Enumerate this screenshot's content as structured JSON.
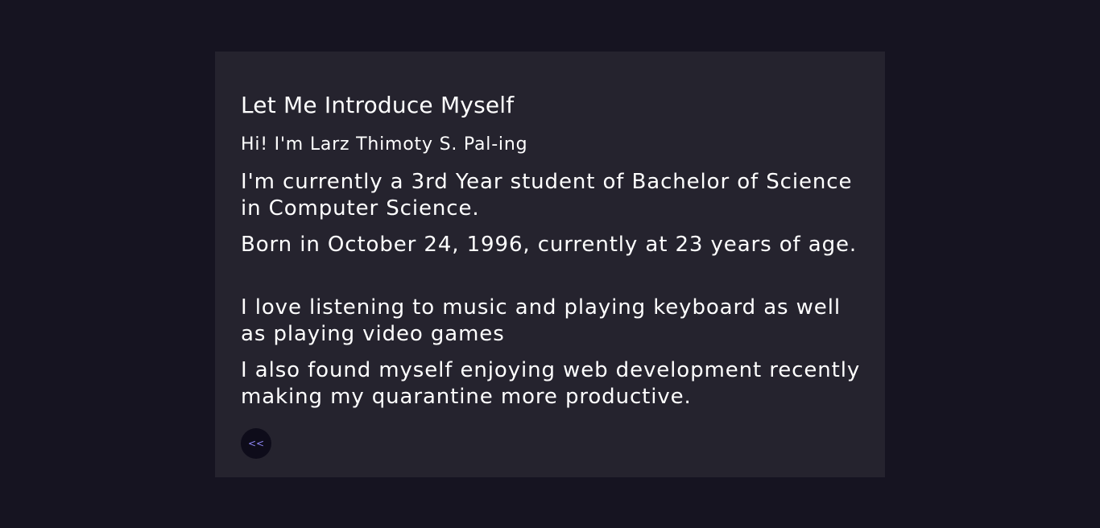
{
  "intro": {
    "title": "Let Me Introduce Myself",
    "greeting": "Hi! I'm Larz Thimoty S. Pal-ing",
    "paragraphs": [
      "I'm currently a 3rd Year student of Bachelor of Science in Computer Science.",
      "Born in October 24, 1996, currently at 23 years of age.",
      "I love listening to music and playing keyboard as well as playing video games",
      "I also found myself enjoying web development recently making my quarantine more productive."
    ],
    "back_label": "<<"
  },
  "colors": {
    "page_background": "#161421",
    "card_background": "#25232e",
    "text": "#ffffff",
    "accent": "#8d86f5"
  }
}
